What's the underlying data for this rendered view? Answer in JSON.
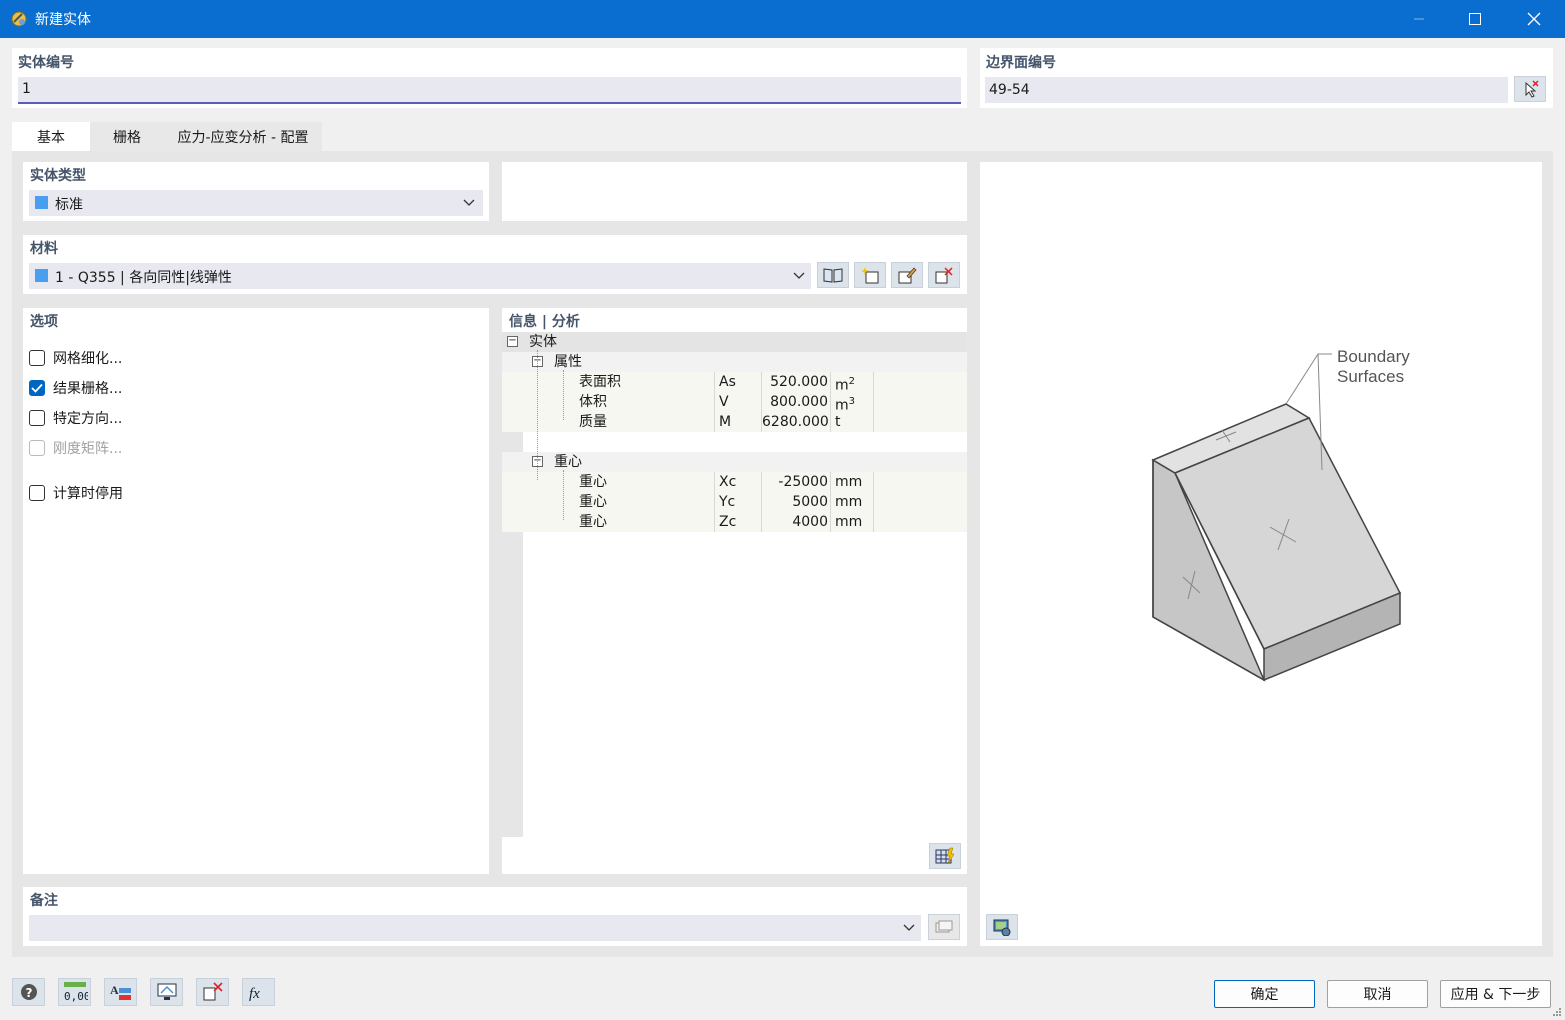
{
  "window": {
    "title": "新建实体",
    "minimize_icon": "minimize-icon",
    "maximize_icon": "maximize-icon",
    "close_icon": "close-icon"
  },
  "header": {
    "solid_no_label": "实体编号",
    "solid_no_value": "1",
    "boundary_label": "边界面编号",
    "boundary_value": "49-54"
  },
  "tabs": [
    {
      "label": "基本",
      "active": true
    },
    {
      "label": "栅格",
      "active": false
    },
    {
      "label": "应力-应变分析 - 配置",
      "active": false
    }
  ],
  "solid_type": {
    "label": "实体类型",
    "value": "标准",
    "swatch_color": "#4a9ef0"
  },
  "material": {
    "label": "材料",
    "value": "1 - Q355 | 各向同性|线弹性",
    "swatch_color": "#4a9ef0"
  },
  "options": {
    "label": "选项",
    "items": [
      {
        "label": "网格细化...",
        "checked": false,
        "enabled": true
      },
      {
        "label": "结果栅格...",
        "checked": true,
        "enabled": true
      },
      {
        "label": "特定方向...",
        "checked": false,
        "enabled": true
      },
      {
        "label": "刚度矩阵...",
        "checked": false,
        "enabled": false
      },
      {
        "label": "计算时停用",
        "checked": false,
        "enabled": true
      }
    ]
  },
  "info": {
    "label": "信息 | 分析",
    "root": "实体",
    "group1": "属性",
    "rows1": [
      {
        "name": "表面积",
        "sym": "As",
        "val": "520.000",
        "unit": "m",
        "sup": "2"
      },
      {
        "name": "体积",
        "sym": "V",
        "val": "800.000",
        "unit": "m",
        "sup": "3"
      },
      {
        "name": "质量",
        "sym": "M",
        "val": "6280.000",
        "unit": "t",
        "sup": ""
      }
    ],
    "group2": "重心",
    "rows2": [
      {
        "name": "重心",
        "sym": "Xc",
        "val": "-25000",
        "unit": "mm",
        "sup": ""
      },
      {
        "name": "重心",
        "sym": "Yc",
        "val": "5000",
        "unit": "mm",
        "sup": ""
      },
      {
        "name": "重心",
        "sym": "Zc",
        "val": "4000",
        "unit": "mm",
        "sup": ""
      }
    ]
  },
  "preview": {
    "annotation_line1": "Boundary",
    "annotation_line2": "Surfaces"
  },
  "notes": {
    "label": "备注",
    "value": ""
  },
  "footer": {
    "ok": "确定",
    "cancel": "取消",
    "apply_next": "应用 & 下一步",
    "zero_label": "0,00"
  }
}
